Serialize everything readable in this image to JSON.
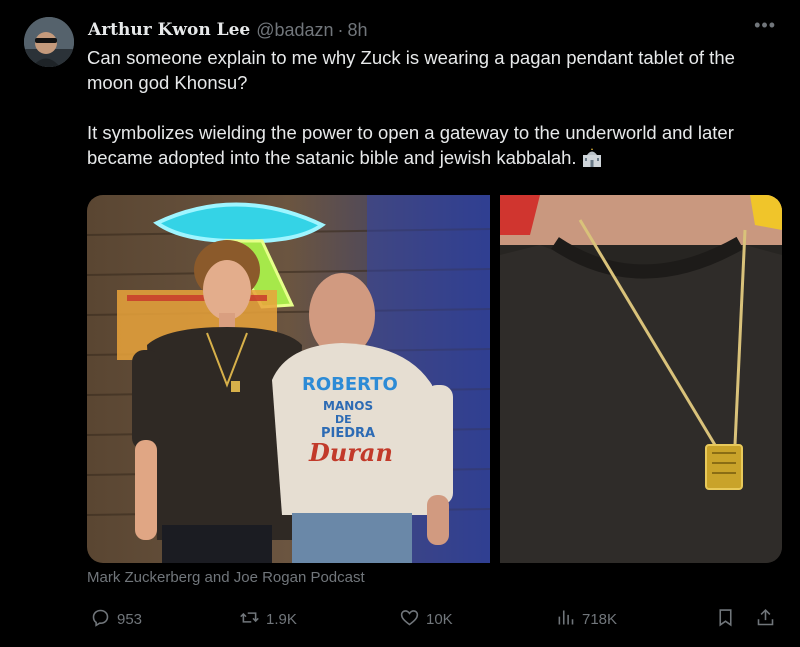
{
  "tweet": {
    "author_name": "Arthur Kwon Lee",
    "handle": "@badazn",
    "separator": "·",
    "time": "8h",
    "more_label": "•••",
    "paragraphs": [
      "Can someone explain to me why Zuck is wearing a pagan pendant tablet of the moon god Khonsu?",
      "It symbolizes wielding the power to open a gateway to the underworld and later became adopted into the satanic bible and jewish kabbalah."
    ],
    "emoji": "synagogue-emoji",
    "media": [
      {
        "description_icon": "photo",
        "hoodie_text": [
          "ROBERTO",
          "MANOS",
          "DE",
          "PIEDRA",
          "Duran"
        ]
      },
      {
        "description_icon": "photo"
      }
    ],
    "caption": "Mark Zuckerberg and Joe Rogan Podcast"
  },
  "actions": {
    "reply_count": "953",
    "retweet_count": "1.9K",
    "like_count": "10K",
    "view_count": "718K"
  },
  "colors": {
    "background": "#000000",
    "text": "#e7e9ea",
    "muted": "#71767b"
  }
}
